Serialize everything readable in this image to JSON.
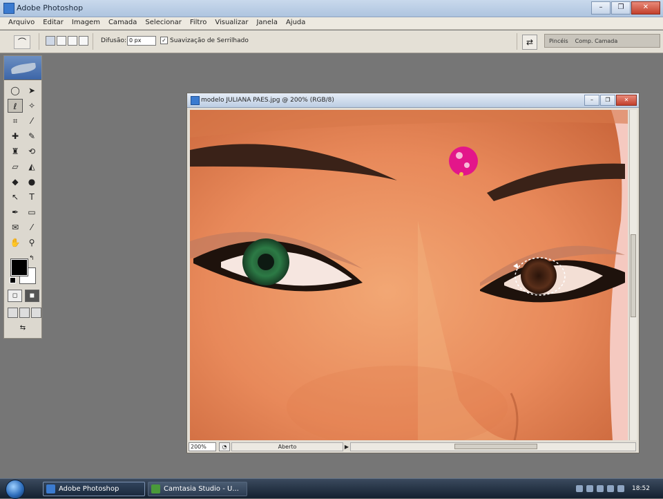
{
  "app": {
    "title": "Adobe Photoshop"
  },
  "menu": [
    "Arquivo",
    "Editar",
    "Imagem",
    "Camada",
    "Selecionar",
    "Filtro",
    "Visualizar",
    "Janela",
    "Ajuda"
  ],
  "options": {
    "feather_label": "Difusão:",
    "feather_value": "0 px",
    "antialias_label": "Suavização de Serrilhado",
    "antialias_checked": "✓"
  },
  "palette_well": {
    "tabs": [
      "Pincéis",
      "Comp. Camada"
    ]
  },
  "document": {
    "title": "modelo  JULIANA PAES.jpg @ 200% (RGB/8)",
    "zoom": "200%",
    "status_info": "Aberto"
  },
  "taskbar": {
    "tasks": [
      "Adobe Photoshop",
      "Camtasia Studio - U..."
    ],
    "clock": "18:52"
  },
  "colors": {
    "foreground": "#000000",
    "background": "#ffffff",
    "bindi": "#e3168a",
    "left_iris": "#2c7a45",
    "right_iris": "#5a2f1a"
  },
  "icons": {
    "toolbox": [
      "marquee",
      "move",
      "lasso",
      "magic-wand",
      "crop",
      "slice",
      "healing",
      "brush",
      "stamp",
      "history-brush",
      "eraser",
      "gradient",
      "blur",
      "dodge",
      "path-select",
      "type",
      "pen",
      "shape",
      "notes",
      "eyedropper",
      "hand",
      "zoom"
    ]
  }
}
